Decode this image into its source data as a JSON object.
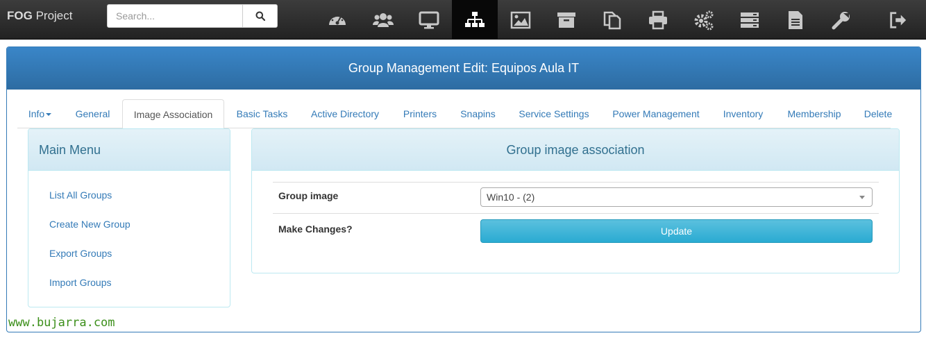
{
  "navbar": {
    "brand_bold": "FOG",
    "brand_rest": " Project",
    "search_placeholder": "Search...",
    "icons": [
      "dashboard-icon",
      "users-icon",
      "desktop-icon",
      "sitemap-icon",
      "image-icon",
      "archive-icon",
      "copy-icon",
      "print-icon",
      "cogs-icon",
      "server-icon",
      "file-icon",
      "wrench-icon",
      "sign-out-icon"
    ],
    "active_icon": "sitemap-icon"
  },
  "panel": {
    "title": "Group Management Edit: Equipos Aula IT"
  },
  "tabs": [
    {
      "label": "Info"
    },
    {
      "label": "General"
    },
    {
      "label": "Image Association"
    },
    {
      "label": "Basic Tasks"
    },
    {
      "label": "Active Directory"
    },
    {
      "label": "Printers"
    },
    {
      "label": "Snapins"
    },
    {
      "label": "Service Settings"
    },
    {
      "label": "Power Management"
    },
    {
      "label": "Inventory"
    },
    {
      "label": "Membership"
    },
    {
      "label": "Delete"
    }
  ],
  "active_tab": "Image Association",
  "main_menu": {
    "title": "Main Menu",
    "items": [
      "List All Groups",
      "Create New Group",
      "Export Groups",
      "Import Groups"
    ]
  },
  "association": {
    "title": "Group image association",
    "group_image_label": "Group image",
    "group_image_value": "Win10 - (2)",
    "make_changes_label": "Make Changes?",
    "update_label": "Update"
  },
  "watermark": "www.bujarra.com",
  "colors": {
    "navbar": "#222222",
    "header": "#337ab7",
    "link": "#337ab7",
    "info_button": "#5bc0de",
    "panel_heading": "#d9edf7"
  }
}
